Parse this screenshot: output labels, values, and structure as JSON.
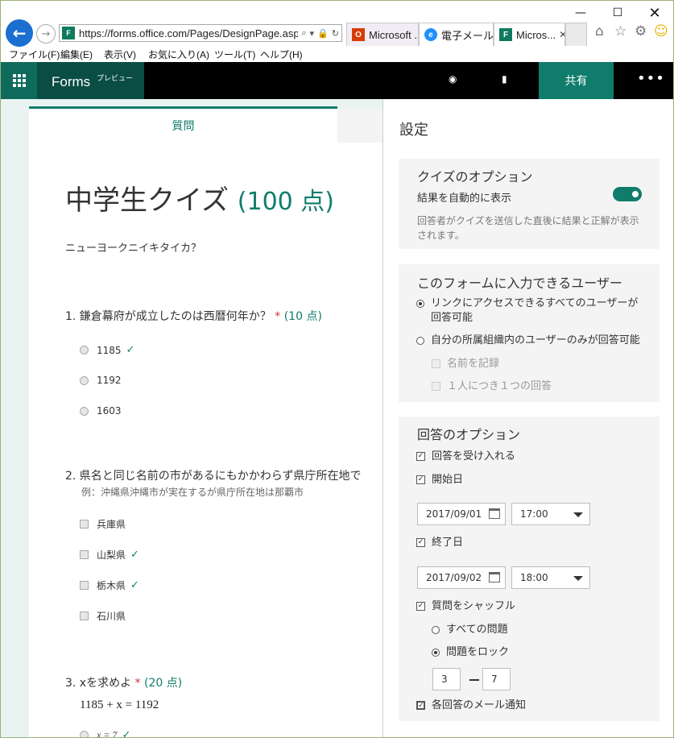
{
  "browser": {
    "url": "https://forms.office.com/Pages/DesignPage.aspx",
    "tabs": [
      {
        "label": "Microsoft ...",
        "icon": "office-icon",
        "color": "#d83b01"
      },
      {
        "label": "電子メール...",
        "icon": "ie-icon",
        "color": "#1e90ff"
      },
      {
        "label": "Micros...",
        "icon": "forms-icon",
        "color": "#0e7a5e"
      }
    ],
    "menu": [
      "ファイル(F)",
      "編集(E)",
      "表示(V)",
      "お気に入り(A)",
      "ツール(T)",
      "ヘルプ(H)"
    ]
  },
  "app": {
    "name": "Forms",
    "badge": "プレビュー",
    "share_label": "共有",
    "accent": "#107c6b"
  },
  "tabs": {
    "questions": "質問"
  },
  "form": {
    "title": "中学生クイズ",
    "points": "(100 点)",
    "description": "ニューヨークニイキタイカ？",
    "questions": [
      {
        "label": "1. 鎌倉幕府が成立したのは西暦何年か？",
        "required": "*",
        "points": "(10 点)",
        "options": [
          {
            "text": "1185",
            "correct": "✓"
          },
          {
            "text": "1192",
            "correct": ""
          },
          {
            "text": "1603",
            "correct": ""
          }
        ]
      },
      {
        "label": "2. 県名と同じ名前の市があるにもかかわらず県庁所在地で",
        "subtitle": "例：沖縄県沖縄市が実在するが県庁所在地は那覇市",
        "options": [
          {
            "text": "兵庫県",
            "correct": ""
          },
          {
            "text": "山梨県",
            "correct": "✓"
          },
          {
            "text": "栃木県",
            "correct": "✓"
          },
          {
            "text": "石川県",
            "correct": ""
          }
        ]
      },
      {
        "label": "3. xを求めよ",
        "required": "*",
        "points": "(20 点)",
        "formula": "1185 + x = 1192",
        "options": [
          {
            "text": "x = 7",
            "correct": "✓"
          }
        ]
      }
    ]
  },
  "settings": {
    "title": "設定",
    "quiz": {
      "heading": "クイズのオプション",
      "auto_show": "結果を自動的に表示",
      "auto_show_on": true,
      "note": "回答者がクイズを送信した直後に結果と正解が表示されます。"
    },
    "access": {
      "heading": "このフォームに入力できるユーザー",
      "option_anyone": "リンクにアクセスできるすべてのユーザーが回答可能",
      "option_org": "自分の所属組織内のユーザーのみが回答可能",
      "record_name": "名前を記録",
      "one_response": "１人につき１つの回答"
    },
    "response": {
      "heading": "回答のオプション",
      "accept": "回答を受け入れる",
      "start_date_label": "開始日",
      "start_date": "2017/09/01",
      "start_time": "17:00",
      "end_date_label": "終了日",
      "end_date": "2017/09/02",
      "end_time": "18:00",
      "shuffle": "質問をシャッフル",
      "all_questions": "すべての問題",
      "lock_questions": "問題をロック",
      "lock_from": "3",
      "lock_to": "7",
      "email_notify": "各回答のメール通知"
    }
  }
}
